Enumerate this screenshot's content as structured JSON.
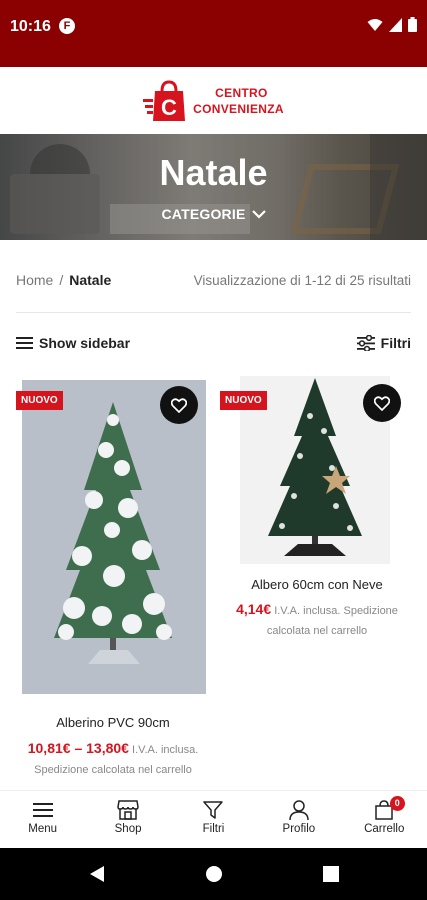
{
  "status_bar": {
    "time": "10:16",
    "app_icon_letter": "F",
    "icons": [
      "wifi-icon",
      "signal-icon",
      "battery-icon"
    ]
  },
  "header": {
    "logo_line1": "CENTRO",
    "logo_line2": "CONVENIENZA"
  },
  "hero": {
    "title": "Natale",
    "categories_label": "CATEGORIE"
  },
  "breadcrumb": {
    "home": "Home",
    "separator": "/",
    "current": "Natale"
  },
  "results_text": "Visualizzazione di 1-12 di 25 risultati",
  "toolbar": {
    "sidebar_label": "Show sidebar",
    "filter_label": "Filtri"
  },
  "products": [
    {
      "badge": "NUOVO",
      "name": "Alberino PVC 90cm",
      "price": "10,81€ – 13,80€",
      "price_note": "I.V.A. inclusa.",
      "shipping_note": "Spedizione calcolata nel carrello"
    },
    {
      "badge": "NUOVO",
      "name": "Albero 60cm con Neve",
      "price": "4,14€",
      "price_note": "I.V.A. inclusa. Spedizione",
      "shipping_note": "calcolata nel carrello"
    }
  ],
  "bottom_nav": [
    {
      "label": "Menu",
      "icon": "menu-icon"
    },
    {
      "label": "Shop",
      "icon": "shop-icon"
    },
    {
      "label": "Filtri",
      "icon": "filter-icon"
    },
    {
      "label": "Profilo",
      "icon": "user-icon"
    },
    {
      "label": "Carrello",
      "icon": "cart-icon",
      "count": "0"
    }
  ],
  "colors": {
    "brand_red": "#d6141e",
    "status_bar": "#8b0000"
  }
}
